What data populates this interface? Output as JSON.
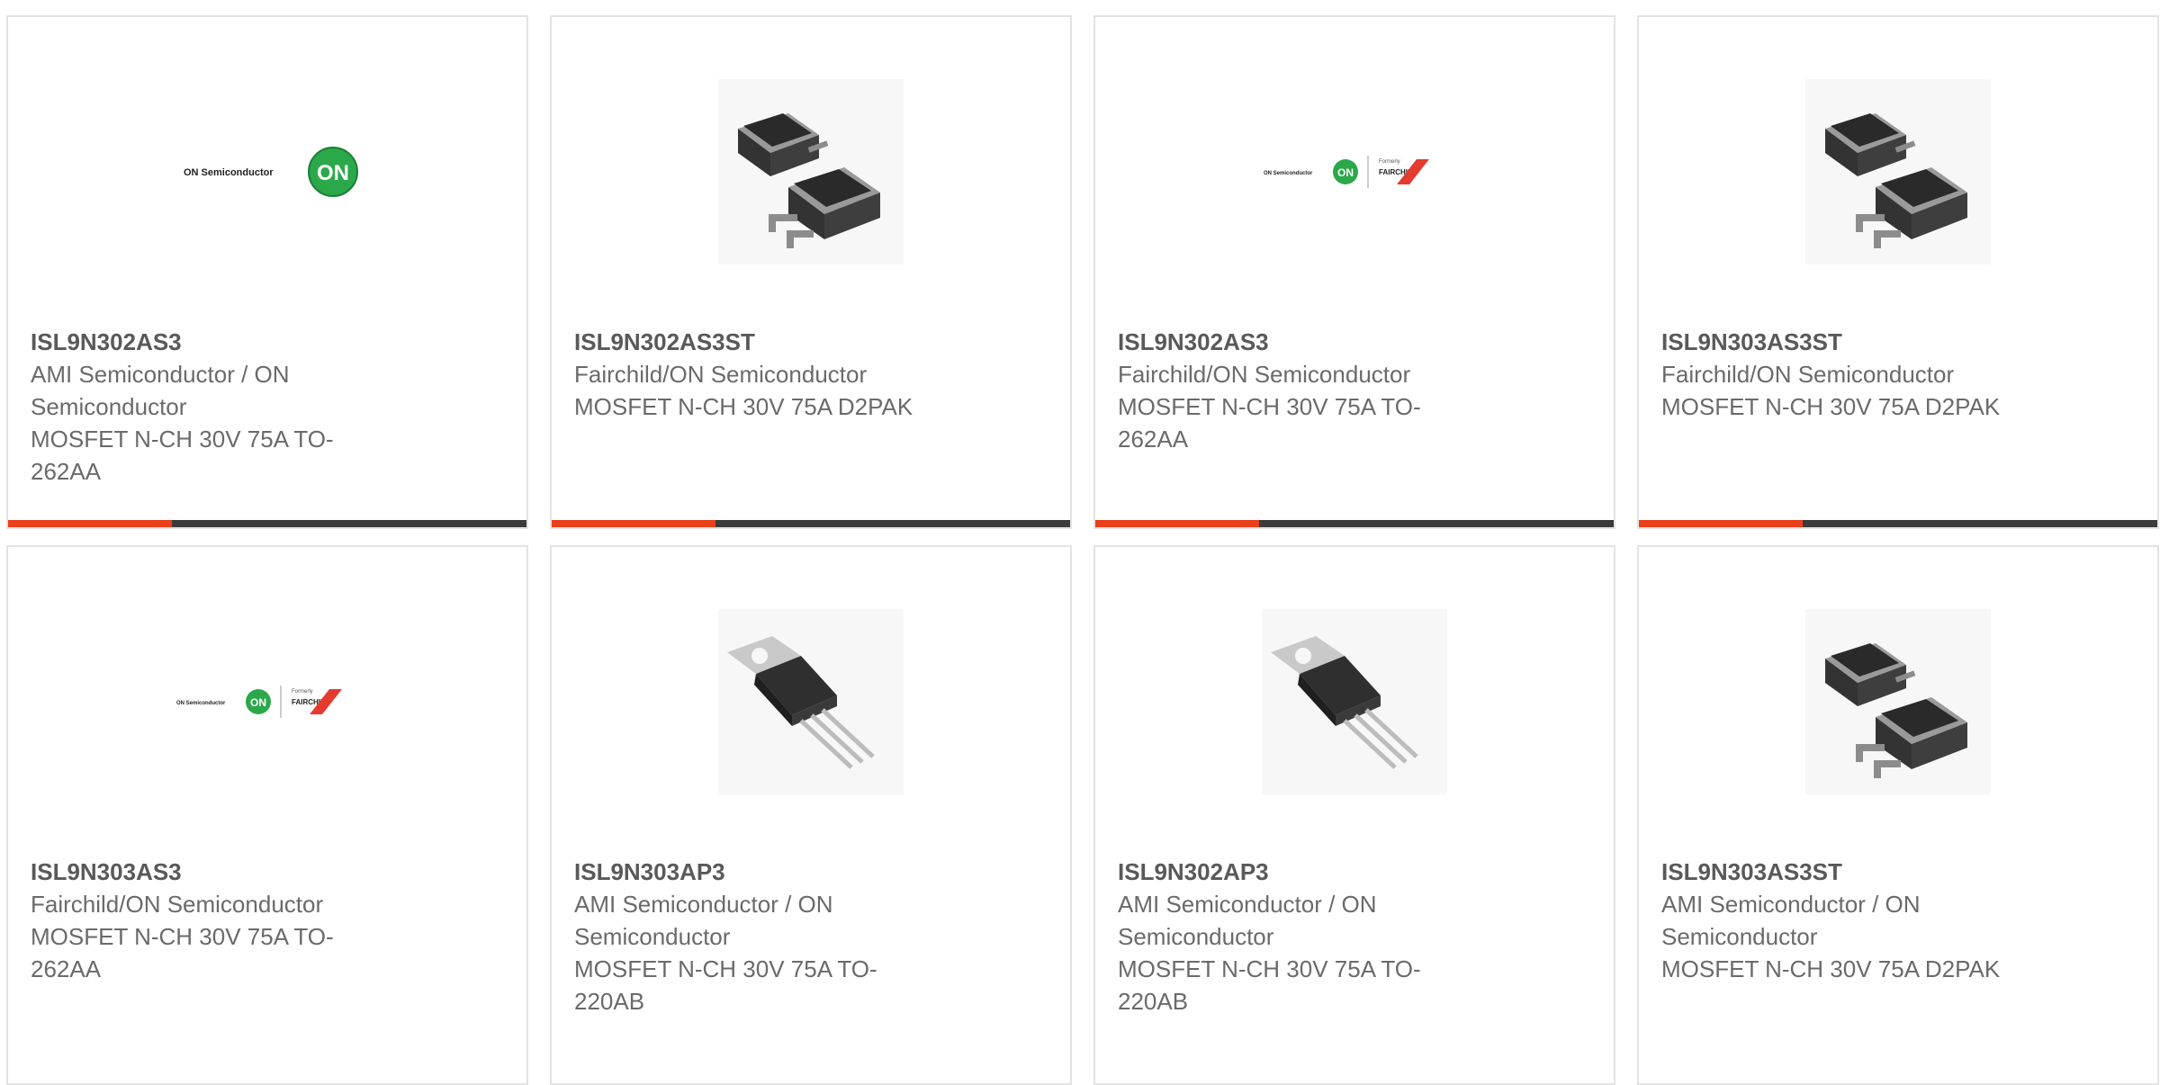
{
  "logos": {
    "on_wordmark": "ON Semiconductor",
    "on_badge": "ON",
    "formerly": "Formerly",
    "fairchild": "FAIRCHILD"
  },
  "colors": {
    "accent": "#e8401a",
    "bar": "#3b3b3b",
    "on_green": "#2aa84a",
    "fairchild_red": "#e53a2e"
  },
  "cards": [
    {
      "image": "on-semi-logo",
      "part": "ISL9N302AS3",
      "lines": [
        "AMI Semiconductor / ON",
        "Semiconductor",
        "MOSFET N-CH 30V 75A TO-",
        "262AA"
      ]
    },
    {
      "image": "d2pak-package",
      "part": "ISL9N302AS3ST",
      "lines": [
        "Fairchild/ON Semiconductor",
        "MOSFET N-CH 30V 75A D2PAK"
      ]
    },
    {
      "image": "on-fairchild-logo",
      "part": "ISL9N302AS3",
      "lines": [
        "Fairchild/ON Semiconductor",
        "MOSFET N-CH 30V 75A TO-",
        "262AA"
      ]
    },
    {
      "image": "d2pak-package",
      "part": "ISL9N303AS3ST",
      "lines": [
        "Fairchild/ON Semiconductor",
        "MOSFET N-CH 30V 75A D2PAK"
      ]
    },
    {
      "image": "on-fairchild-logo",
      "part": "ISL9N303AS3",
      "lines": [
        "Fairchild/ON Semiconductor",
        "MOSFET N-CH 30V 75A TO-",
        "262AA"
      ]
    },
    {
      "image": "to220-package",
      "part": "ISL9N303AP3",
      "lines": [
        "AMI Semiconductor / ON",
        "Semiconductor",
        "MOSFET N-CH 30V 75A TO-",
        "220AB"
      ]
    },
    {
      "image": "to220-package",
      "part": "ISL9N302AP3",
      "lines": [
        "AMI Semiconductor / ON",
        "Semiconductor",
        "MOSFET N-CH 30V 75A TO-",
        "220AB"
      ]
    },
    {
      "image": "d2pak-package",
      "part": "ISL9N303AS3ST",
      "lines": [
        "AMI Semiconductor / ON",
        "Semiconductor",
        "MOSFET N-CH 30V 75A D2PAK"
      ]
    }
  ]
}
